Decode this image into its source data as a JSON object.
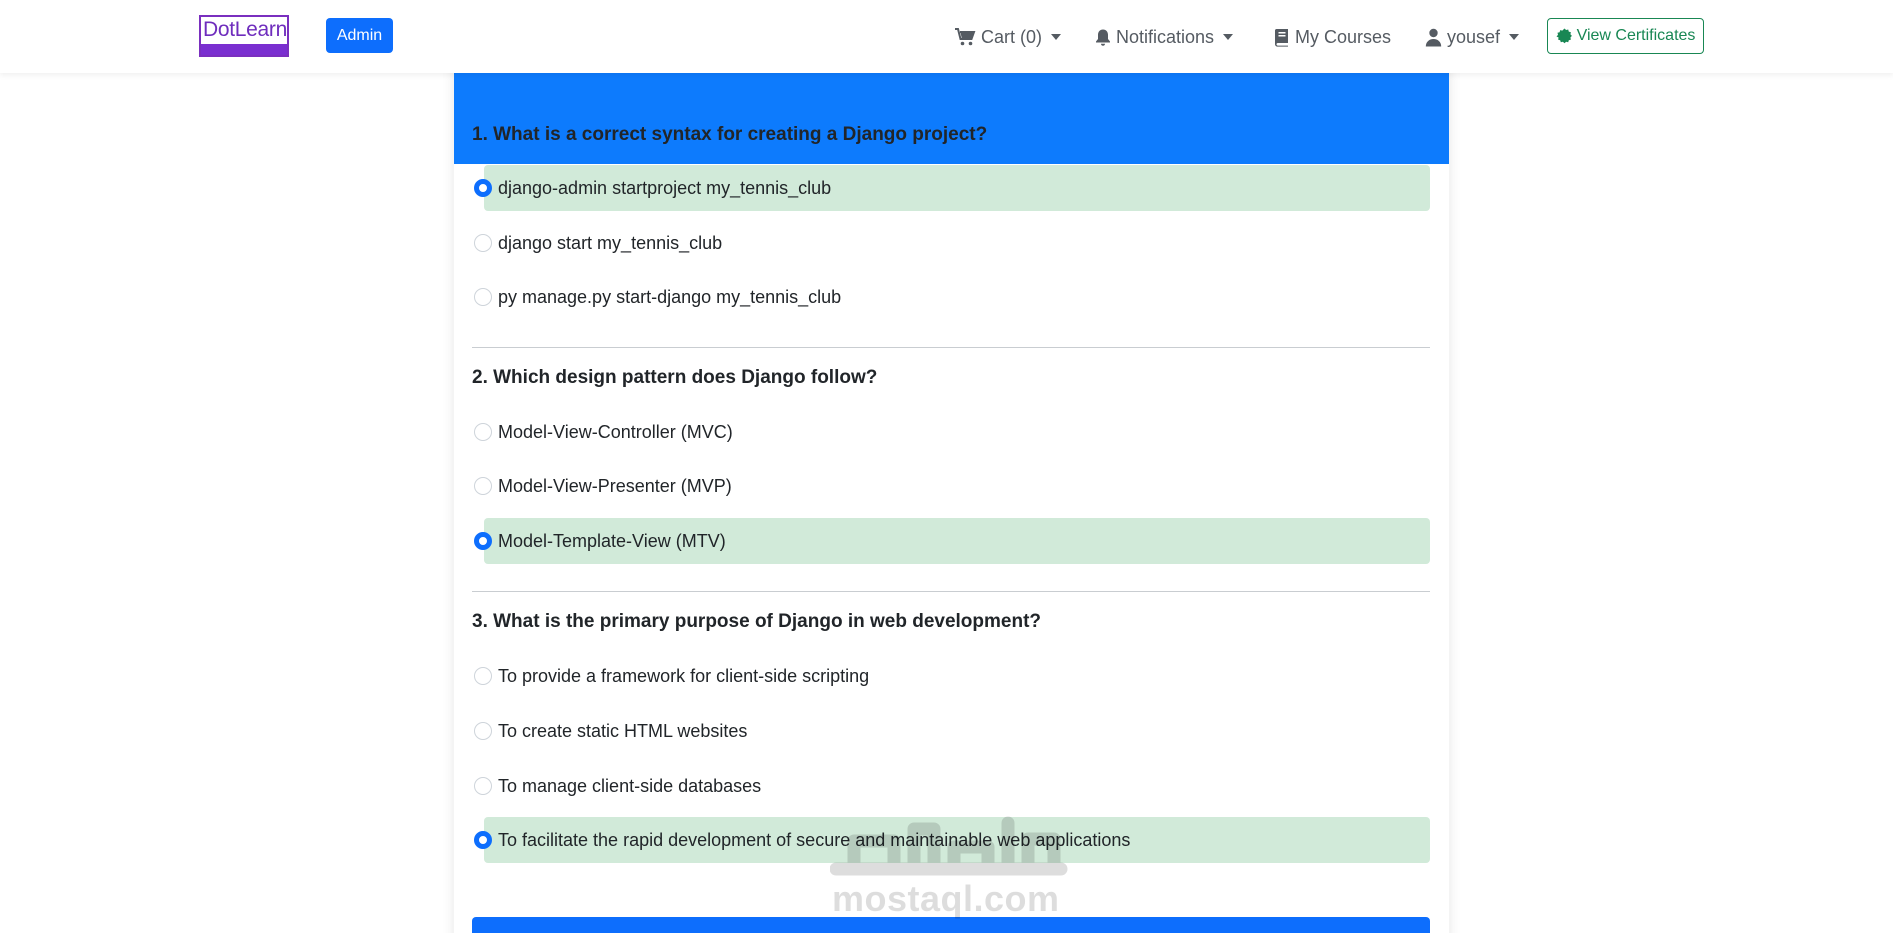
{
  "brand": {
    "logo_text": "DotLearn"
  },
  "navbar": {
    "admin_label": "Admin",
    "cart_label": "Cart (0)",
    "notifications_label": "Notifications",
    "my_courses_label": "My Courses",
    "user_label": "yousef",
    "certificates_label": "View Certificates"
  },
  "colors": {
    "primary": "#0d6efd",
    "success": "#198754",
    "selected_bg": "#d1ead9",
    "brand": "#7a2fd0"
  },
  "quiz": {
    "questions": [
      {
        "text": "1. What is a correct syntax for creating a Django project?",
        "options": [
          {
            "label": "django-admin startproject my_tennis_club",
            "selected": true
          },
          {
            "label": "django start my_tennis_club",
            "selected": false
          },
          {
            "label": "py manage.py start-django my_tennis_club",
            "selected": false
          }
        ]
      },
      {
        "text": "2. Which design pattern does Django follow?",
        "options": [
          {
            "label": "Model-View-Controller (MVC)",
            "selected": false
          },
          {
            "label": "Model-View-Presenter (MVP)",
            "selected": false
          },
          {
            "label": "Model-Template-View (MTV)",
            "selected": true
          }
        ]
      },
      {
        "text": "3. What is the primary purpose of Django in web development?",
        "options": [
          {
            "label": "To provide a framework for client-side scripting",
            "selected": false
          },
          {
            "label": "To create static HTML websites",
            "selected": false
          },
          {
            "label": "To manage client-side databases",
            "selected": false
          },
          {
            "label": "To facilitate the rapid development of secure and maintainable web applications",
            "selected": true
          }
        ]
      }
    ]
  },
  "watermark": {
    "text": "mostaql.com"
  }
}
